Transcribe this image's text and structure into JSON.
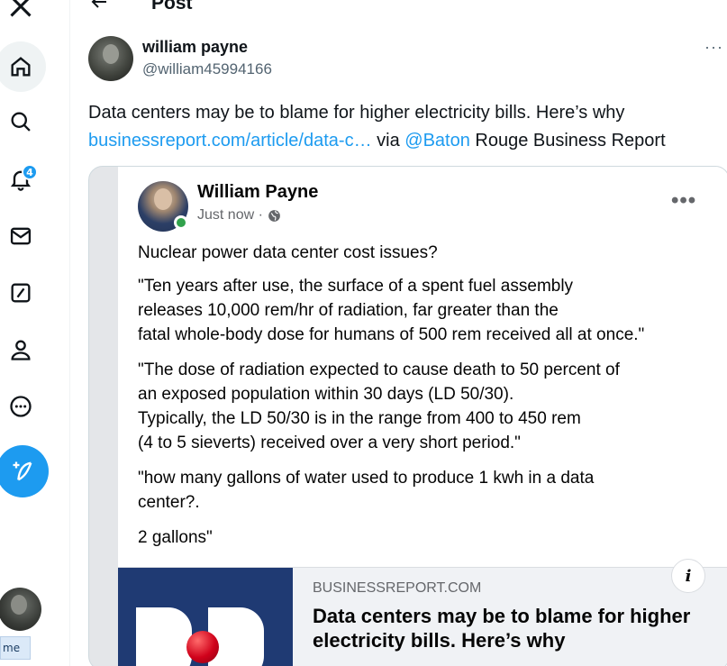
{
  "header": {
    "title": "Post"
  },
  "nav": {
    "notification_count": "4",
    "tooltip": "me"
  },
  "post": {
    "author_name": "william payne",
    "author_handle": "@william45994166",
    "more": "···",
    "text_part1": "Data centers may be to blame for higher electricity bills. Here’s why ",
    "link_text": "businessreport.com/article/data-c…",
    "text_part2": " via ",
    "mention": "@Baton",
    "text_part3": " Rouge Business Report"
  },
  "embed": {
    "author_name": "William Payne",
    "time": "Just now ·",
    "more": "•••",
    "paragraphs": [
      "Nuclear power data center cost issues?",
      "\"Ten years after use, the surface of a spent fuel assembly\nreleases 10,000 rem/hr of radiation, far greater than the\nfatal whole-body dose for humans of 500 rem received all at once.\"",
      "\"The dose of radiation expected to cause death to 50 percent of\nan exposed population within 30 days (LD 50/30).\nTypically, the LD 50/30 is in the range from 400 to 450 rem\n(4 to 5 sieverts) received over a very short period.\"",
      "\"how many gallons of water used to produce 1 kwh in a data\ncenter?.",
      "2 gallons\""
    ],
    "link_card": {
      "domain": "BUSINESSREPORT.COM",
      "title": "Data centers may be to blame for higher electricity bills. Here’s why",
      "info": "i"
    }
  },
  "colors": {
    "accent": "#1d9bf0",
    "online": "#31a24c",
    "logo_bg": "#1f3a73"
  }
}
